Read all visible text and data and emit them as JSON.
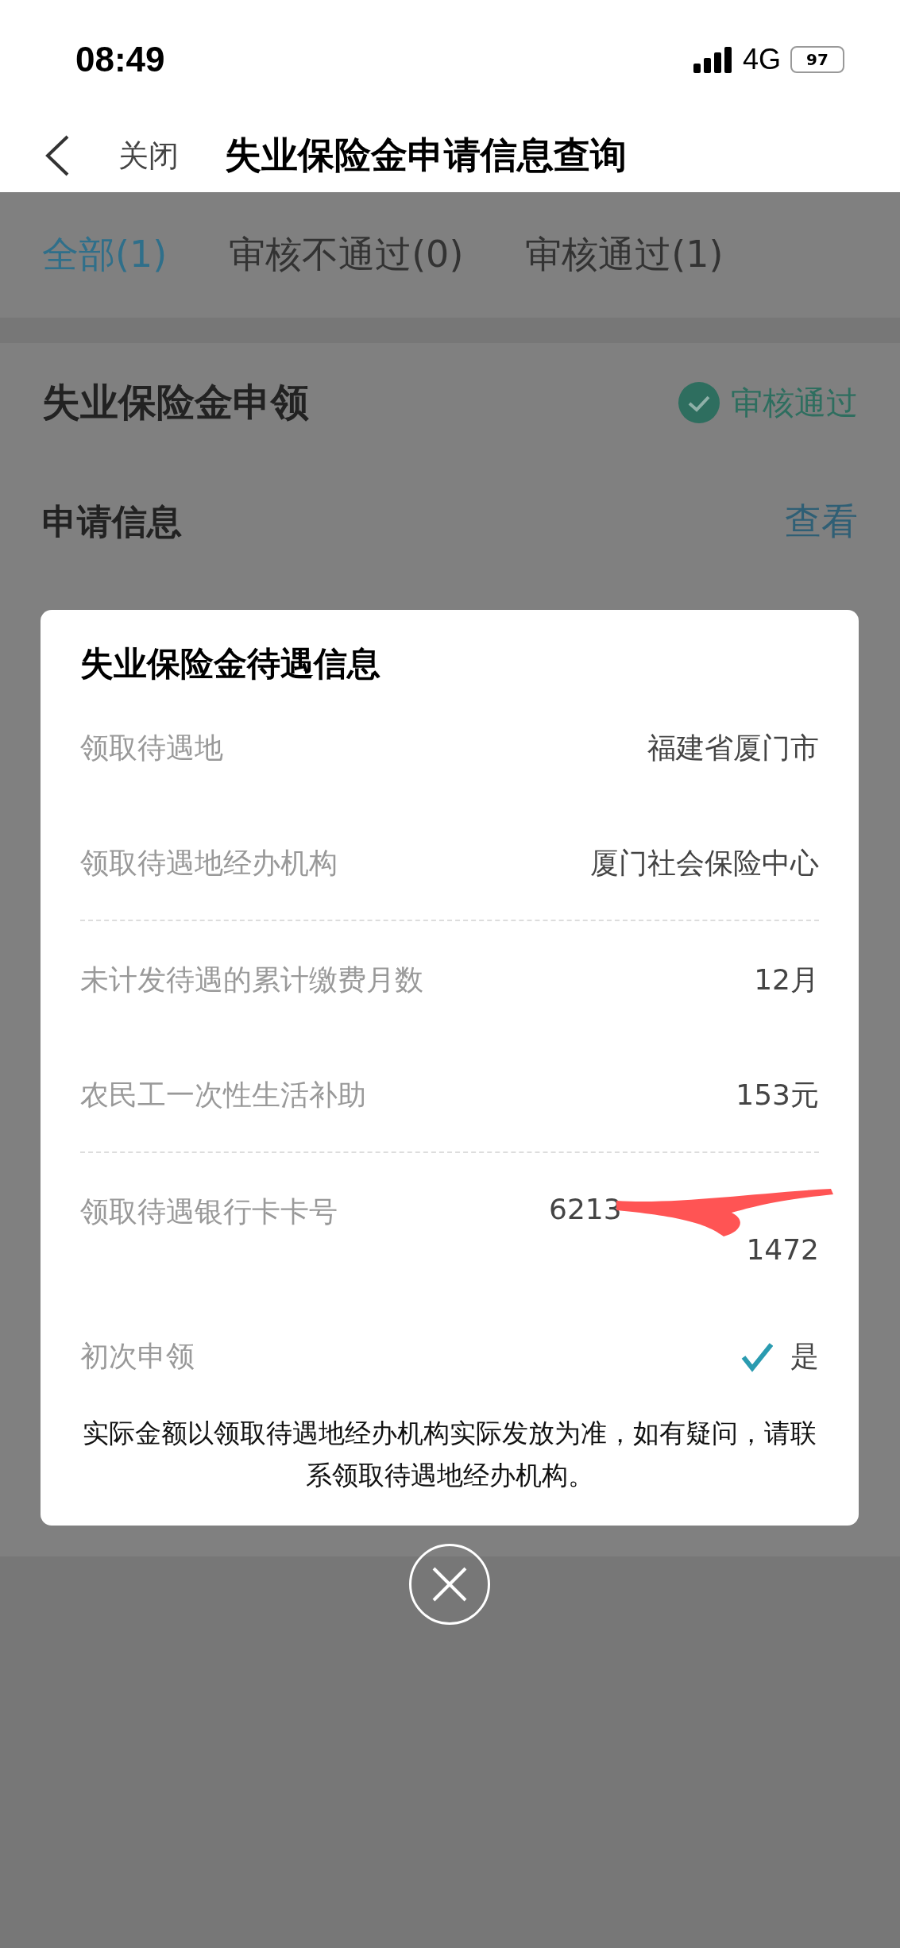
{
  "status_bar": {
    "time": "08:49",
    "network": "4G",
    "battery": "97"
  },
  "nav": {
    "close": "关闭",
    "title": "失业保险金申请信息查询"
  },
  "tabs": [
    {
      "label": "全部(1)",
      "selected": true
    },
    {
      "label": "审核不通过(0)",
      "selected": false
    },
    {
      "label": "审核通过(1)",
      "selected": false
    }
  ],
  "card": {
    "title": "失业保险金申领",
    "status": "审核通过",
    "section": "申请信息",
    "link": "查看"
  },
  "modal": {
    "title": "失业保险金待遇信息",
    "rows": [
      {
        "kind": "text",
        "label": "领取待遇地",
        "value": "福建省厦门市"
      },
      {
        "kind": "text",
        "label": "领取待遇地经办机构",
        "value": "厦门社会保险中心"
      },
      {
        "kind": "divider"
      },
      {
        "kind": "text",
        "label": "未计发待遇的累计缴费月数",
        "value": "12月"
      },
      {
        "kind": "text",
        "label": "农民工一次性生活补助",
        "value": "153元"
      },
      {
        "kind": "divider"
      },
      {
        "kind": "card",
        "label": "领取待遇银行卡卡号",
        "lines": [
          "6213",
          "1472"
        ]
      },
      {
        "kind": "check",
        "label": "初次申领",
        "value": "是",
        "checked": true
      }
    ],
    "note": "实际金额以领取待遇地经办机构实际发放为准，如有疑问，请联系领取待遇地经办机构。"
  }
}
